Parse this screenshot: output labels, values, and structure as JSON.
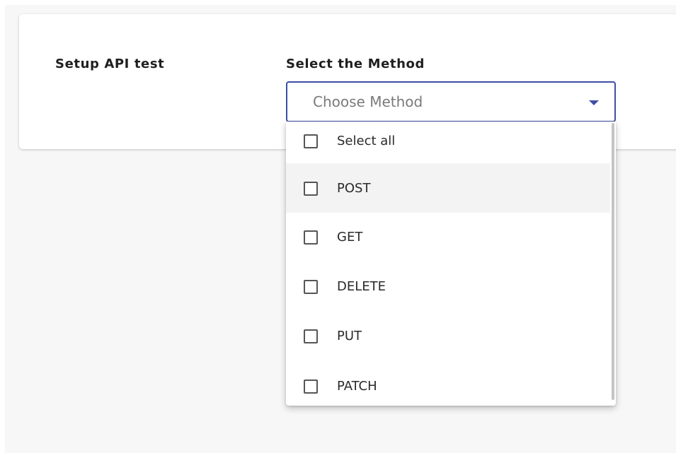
{
  "setup": {
    "title": "Setup API test"
  },
  "method_field": {
    "label": "Select the Method",
    "placeholder": "Choose Method"
  },
  "dropdown": {
    "options": [
      {
        "label": "Select all",
        "checked": false
      },
      {
        "label": "POST",
        "checked": false,
        "highlighted": true
      },
      {
        "label": "GET",
        "checked": false
      },
      {
        "label": "DELETE",
        "checked": false
      },
      {
        "label": "PUT",
        "checked": false
      },
      {
        "label": "PATCH",
        "checked": false
      }
    ]
  },
  "colors": {
    "accent": "#3e4fa3",
    "page_background": "#f7f7f7",
    "highlight": "#f3f3f3"
  },
  "icons": {
    "dropdown": "caret-down-icon",
    "checkbox": "checkbox-unchecked-icon"
  }
}
